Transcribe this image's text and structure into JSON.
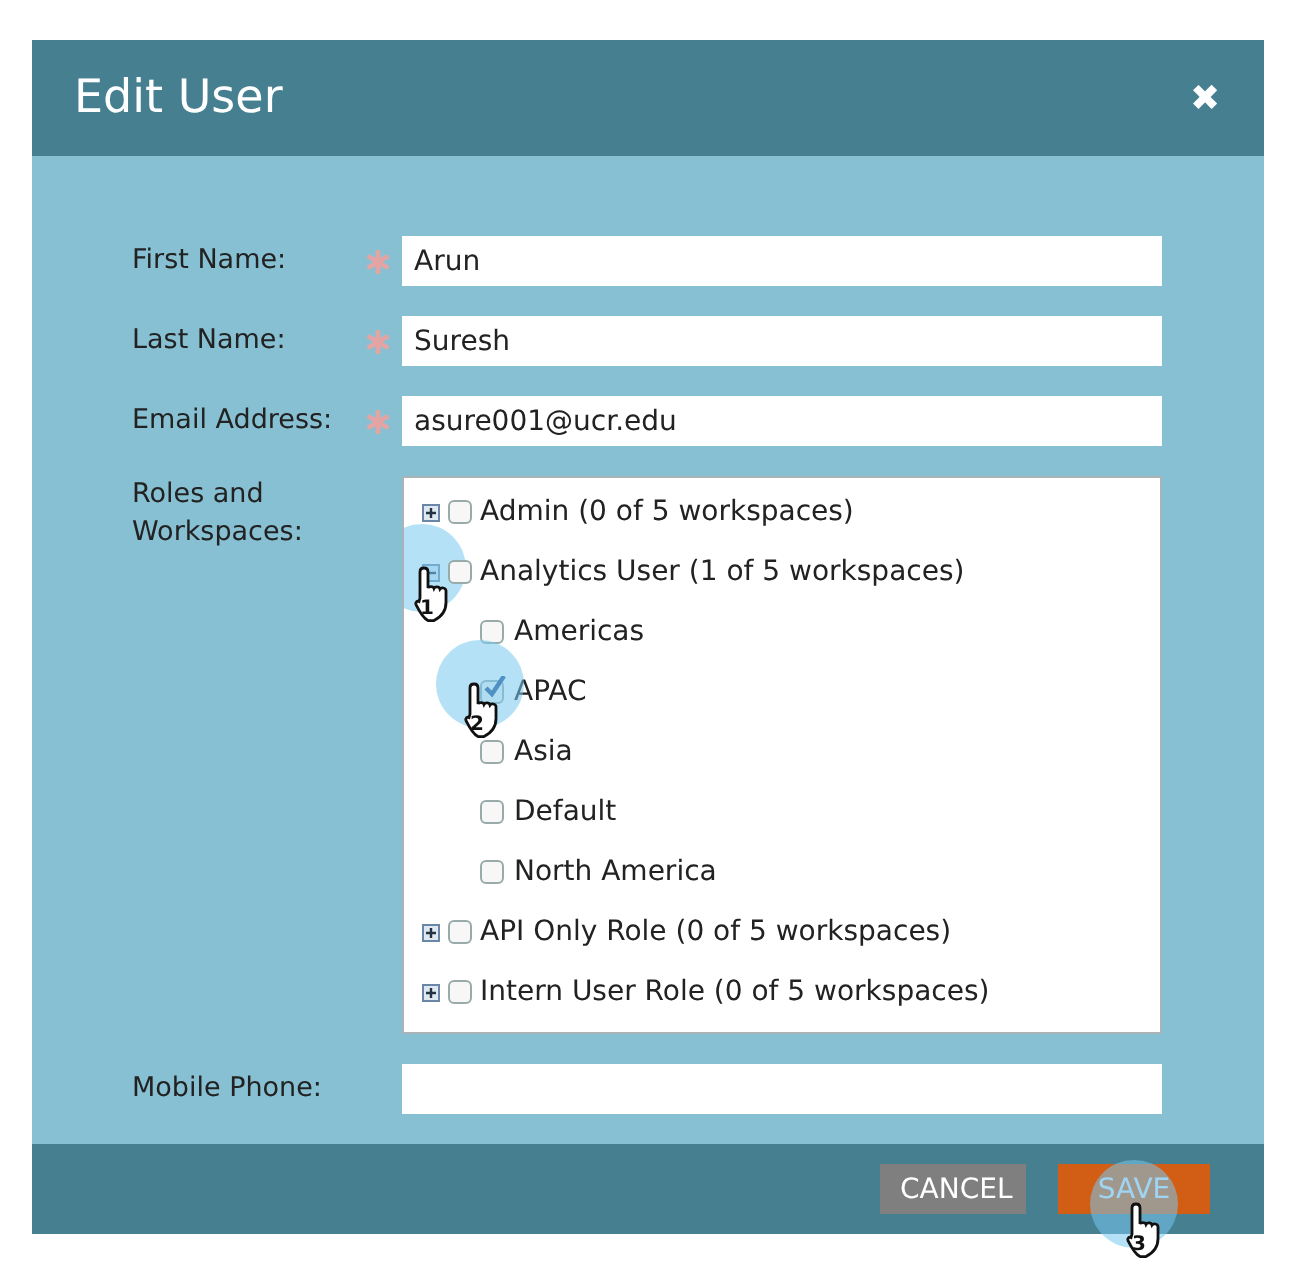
{
  "dialog": {
    "title": "Edit User",
    "close": "✖"
  },
  "fields": [
    {
      "label": "First Name:",
      "required": true,
      "value": "Arun"
    },
    {
      "label": "Last Name:",
      "required": true,
      "value": "Suresh"
    },
    {
      "label": "Email Address:",
      "required": true,
      "value": "asure001@ucr.edu"
    }
  ],
  "roles_field": {
    "label": "Roles and Workspaces:",
    "roles": [
      {
        "label": "Admin (0 of 5 workspaces)",
        "expanded": false,
        "checked": false
      },
      {
        "label": "Analytics User (1 of 5 workspaces)",
        "expanded": true,
        "checked": false,
        "marker": "1",
        "children": [
          {
            "label": "Americas",
            "checked": false
          },
          {
            "label": "APAC",
            "checked": true,
            "marker": "2"
          },
          {
            "label": "Asia",
            "checked": false
          },
          {
            "label": "Default",
            "checked": false
          },
          {
            "label": "North America",
            "checked": false
          }
        ]
      },
      {
        "label": "API Only Role (0 of 5 workspaces)",
        "expanded": false,
        "checked": false
      },
      {
        "label": "Intern User Role (0 of 5 workspaces)",
        "expanded": false,
        "checked": false
      }
    ]
  },
  "mobile": {
    "label": "Mobile Phone:"
  },
  "buttons": [
    {
      "label": "CANCEL",
      "kind": "secondary"
    },
    {
      "label": "SAVE",
      "kind": "primary",
      "marker": "3"
    }
  ]
}
